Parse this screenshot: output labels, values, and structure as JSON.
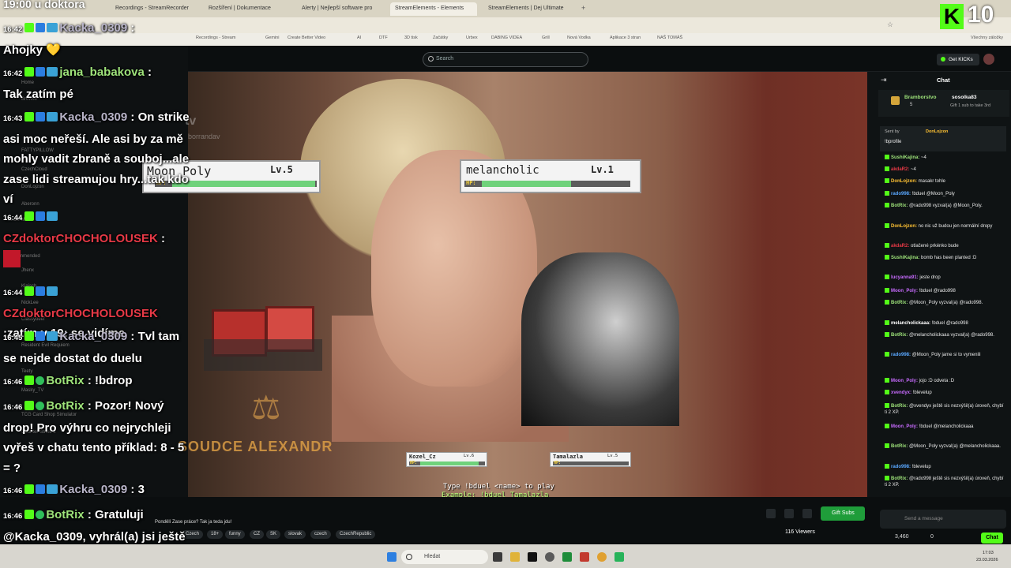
{
  "browser": {
    "tabs": [
      "Recordings - StreamRecorder",
      "Recordings - StreamRecorder",
      "Rozšíření | Dokumentace",
      "Alerty | Nejlepší software pro",
      "StreamElements - Elements",
      "StreamElements | Dej Ultimate"
    ],
    "bookmarks": [
      "Recordings - Stream",
      "Gemini",
      "Create Better Video",
      "AI",
      "DTF",
      "3D tisk",
      "Začátky",
      "Urbex",
      "DABING VIDEA",
      "Grill",
      "Nová Vodka",
      "Aplikace 3 stran",
      "NAŠ TOMÁŠ"
    ],
    "bookmarks_right": "Všechny záložky"
  },
  "header": {
    "search_placeholder": "Search",
    "get_kicks": "Get KICKs"
  },
  "overlay": {
    "clock": "19:00 u doktora",
    "kick_count": "10",
    "kick_letter": "K",
    "messages": [
      {
        "ts": "16:42",
        "user": "Kacka_0309",
        "sep": " :",
        "text": "Ahojky 💛"
      },
      {
        "ts": "16:42",
        "user": "jana_babakova",
        "sep": " :",
        "text": "Tak zatím pé"
      },
      {
        "ts": "16:43",
        "user": "Kacka_0309",
        "sep": " :",
        "text": " On strike asi moc neřeší. Ale asi by za mě mohly vadit zbraně a souboj...ale zase lidi streamujou hry...tak kdo ví"
      },
      {
        "ts": "16:44",
        "user": "CZdoktorCHOCHOLOUSEK",
        "sep": " :",
        "text": ""
      },
      {
        "ts": "16:44",
        "user": "CZdoktorCHOCHOLOUSEK",
        "sep": " :",
        "text": "zatím v 19: se vidíme"
      },
      {
        "ts": "16:45",
        "user": "Kacka_0309",
        "sep": " :",
        "text": " Tvl tam se nejde dostat do duelu"
      },
      {
        "ts": "16:46",
        "user": "BotRix",
        "sep": " :",
        "text": " !bdrop"
      },
      {
        "ts": "16:46",
        "user": "BotRix",
        "sep": " :",
        "text": " Pozor! Nový drop! Pro výhru co nejrychleji vyřeš v chatu tento příklad: 8 - 5 = ?"
      },
      {
        "ts": "16:46",
        "user": "Kacka_0309",
        "sep": " :",
        "text": " 3"
      },
      {
        "ts": "16:46",
        "user": "BotRix",
        "sep": " :",
        "text": " Gratuluji @Kacka_0309, vyhrál(a) jsi ještě jednu hru!"
      }
    ]
  },
  "leftnav": {
    "items": [
      "Home",
      "Browse",
      "FATTYPILLOW",
      "CzechCloud",
      "DonLojzon",
      "Aberonn",
      "Show More",
      "Recommended",
      "Jhenx",
      "Klaisch",
      "NickLee",
      "Classybeef",
      "Resident Evil Requiem",
      "Teety",
      "Masky_TV",
      "TCG Card Shop Simulator",
      "Counter-Strike 2"
    ],
    "label_tv": "tv",
    "channel": "borrandav"
  },
  "game": {
    "player_left": {
      "name": "Moon_Poly",
      "level": "Lv.5",
      "hp_label": "HP:",
      "hp": 1.0
    },
    "player_right": {
      "name": "melancholic",
      "level": "Lv.1",
      "hp_label": "HP:",
      "hp": 0.6
    },
    "mini_left": {
      "name": "Kozel_Cz",
      "level": "Lv.6",
      "hp_label": "HP:",
      "hp": 0.9
    },
    "mini_right": {
      "name": "Tamalazla",
      "level": "Lv.5",
      "hp_label": "HP:",
      "hp": 0.0
    },
    "judge": "SOUDCE ALEXANDR",
    "hint1": "Type !bduel <name> to play",
    "hint2": "Example: !bduel Tamalazla"
  },
  "stream_info": {
    "title": "Pondělí Zase práce? Tak ja teda jdu!",
    "tags": [
      "Czech",
      "18+",
      "funny",
      "CZ",
      "SK",
      "slovak",
      "czech",
      "CzechRepublic"
    ],
    "viewers": "116 Viewers",
    "gift_subs": "Gift Subs"
  },
  "chat": {
    "title": "Chat",
    "pinned_user": "Bramborstvo",
    "pinned_count": "5",
    "pinned_gifter": "sosolka83",
    "pinned_note": "Gift 1 sub to take 3rd",
    "sent_by": "Sent by",
    "sent_by_user": "DonLojzon",
    "profile_cmd": "!bprofile",
    "messages": [
      {
        "user": "SushiKajina:",
        "text": " ~4"
      },
      {
        "user": "akdaR2:",
        "text": " ~4"
      },
      {
        "user": "DonLojzon:",
        "text": " masakr tohle"
      },
      {
        "user": "rado998:",
        "text": " !bduel @Moon_Poly"
      },
      {
        "user": "BotRix:",
        "text": " @rado998 vyzval(a) @Moon_Poly."
      },
      {
        "user": "DonLojzon:",
        "text": " no nic už budou jen normální dropy"
      },
      {
        "user": "akdaR2:",
        "text": " otlačené prkénko bude"
      },
      {
        "user": "SushiKajina:",
        "text": " bomb has been planted :D"
      },
      {
        "user": "lucyanna91:",
        "text": " jeste drop"
      },
      {
        "user": "Moon_Poly:",
        "text": " !bduel @rado998"
      },
      {
        "user": "BotRix:",
        "text": " @Moon_Poly vyzval(a) @rado998."
      },
      {
        "user": "melancholickaaa:",
        "text": " !bduel @rado998"
      },
      {
        "user": "BotRix:",
        "text": " @melancholickaaa vyzval(a) @rado998."
      },
      {
        "user": "rado998:",
        "text": " @Moon_Poly jame si to vymenili"
      },
      {
        "user": "Moon_Poly:",
        "text": " jojo :D odveta :D"
      },
      {
        "user": "xvendyx:",
        "text": " !blevelup"
      },
      {
        "user": "BotRix:",
        "text": " @xvendyx ještě sis nezvýšil(a) úroveň, chybí ti 2 XP."
      },
      {
        "user": "Moon_Poly:",
        "text": " !bduel @melancholickaaa"
      },
      {
        "user": "BotRix:",
        "text": " @Moon_Poly vyzval(a) @melancholickaaa."
      },
      {
        "user": "rado998:",
        "text": " !blevelup"
      },
      {
        "user": "BotRix:",
        "text": " @rado998 ještě sis nezvýšil(a) úroveň, chybí ti 2 XP."
      }
    ],
    "send_placeholder": "Send a message",
    "balance": "3,460",
    "count": "0",
    "chat_button": "Chat"
  },
  "taskbar": {
    "search": "Hledat",
    "time": "17:03",
    "date": "23.03.2026"
  },
  "colors": {
    "kick_green": "#53fc18",
    "overlay_red": "#e63946",
    "gift_green": "#1f9d3a"
  }
}
